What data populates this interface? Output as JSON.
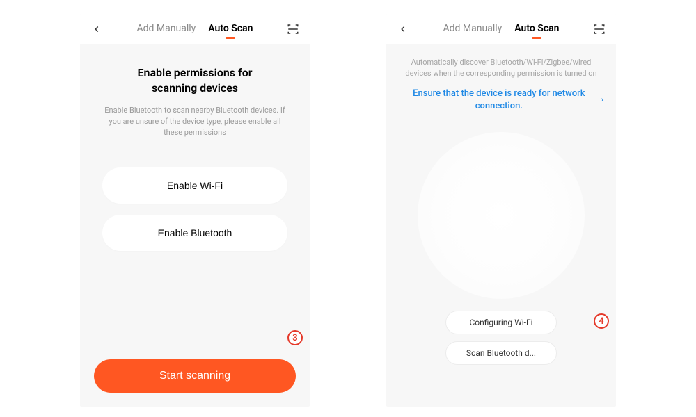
{
  "screen1": {
    "tabs": {
      "manual": "Add Manually",
      "auto": "Auto Scan"
    },
    "heading": "Enable permissions for scanning devices",
    "subtext": "Enable Bluetooth to scan nearby Bluetooth devices. If you are unsure of the device type, please enable all these permissions",
    "enable_wifi": "Enable Wi-Fi",
    "enable_bt": "Enable Bluetooth",
    "start": "Start scanning",
    "step": "3"
  },
  "screen2": {
    "tabs": {
      "manual": "Add Manually",
      "auto": "Auto Scan"
    },
    "discover_text": "Automatically discover Bluetooth/Wi-Fi/Zigbee/wired devices when the corresponding permission is turned on",
    "ready_link": "Ensure that the device is ready for network connection.",
    "configuring": "Configuring Wi-Fi",
    "scan_bt": "Scan Bluetooth d...",
    "step": "4"
  }
}
